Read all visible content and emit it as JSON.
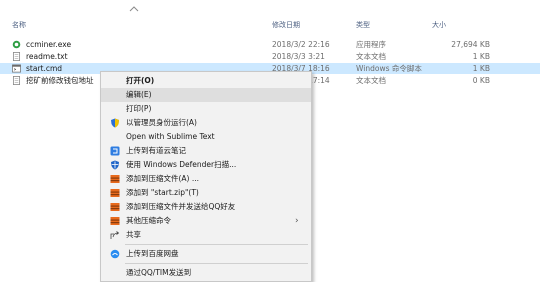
{
  "columns": {
    "name": "名称",
    "date": "修改日期",
    "type": "类型",
    "size": "大小"
  },
  "files": [
    {
      "name": "ccminer.exe",
      "date": "2018/3/2 22:16",
      "type": "应用程序",
      "size": "27,694 KB",
      "icon": "exe-icon"
    },
    {
      "name": "readme.txt",
      "date": "2018/3/3 3:21",
      "type": "文本文档",
      "size": "1 KB",
      "icon": "text-file-icon"
    },
    {
      "name": "start.cmd",
      "date": "2018/3/7 18:16",
      "type": "Windows 命令脚本",
      "size": "1 KB",
      "icon": "script-icon"
    },
    {
      "name": "挖矿前修改钱包地址",
      "date": "2018/3/7 17:14",
      "type": "文本文档",
      "size": "0 KB",
      "icon": "text-file-icon"
    }
  ],
  "context_menu": {
    "open": "打开(O)",
    "edit": "编辑(E)",
    "print": "打印(P)",
    "run_as_admin": "以管理员身份运行(A)",
    "open_sublime": "Open with Sublime Text",
    "upload_youdao": "上传到有道云笔记",
    "defender_scan": "使用 Windows Defender扫描...",
    "add_to_archive": "添加到压缩文件(A) ...",
    "add_to_zip": "添加到 \"start.zip\"(T)",
    "add_send_qq": "添加到压缩文件并发送给QQ好友",
    "other_compress": "其他压缩命令",
    "share": "共享",
    "upload_baidu": "上传到百度网盘",
    "send_qq_tim": "通过QQ/TIM发送到"
  },
  "colors": {
    "selection": "#cce8ff",
    "menu_bg": "#f2f2f2",
    "menu_highlight": "#dedede"
  }
}
